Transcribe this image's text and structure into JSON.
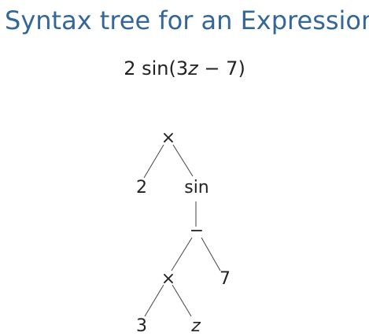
{
  "title": "Syntax tree for an Expression",
  "expression": {
    "coefficient": "2",
    "function": "sin",
    "open_paren": "(",
    "inner_coefficient": "3",
    "variable": "z",
    "operator": "−",
    "constant": "7",
    "close_paren": ")"
  },
  "tree": {
    "root": "×",
    "root_left": "2",
    "root_right": "sin",
    "sin_child": "−",
    "minus_left": "×",
    "minus_right": "7",
    "times_left": "3",
    "times_right": "z"
  },
  "colors": {
    "title": "#336699",
    "text": "#222222",
    "edges": "#444444"
  }
}
